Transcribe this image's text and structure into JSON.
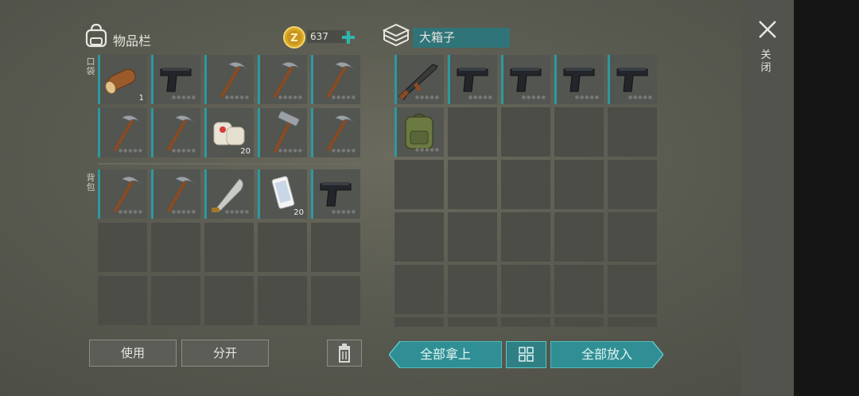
{
  "inventory": {
    "title": "物品栏",
    "coins": "637",
    "coin_symbol": "Z",
    "pocket_label": "口袋",
    "backpack_label": "背包",
    "pocket_items": [
      {
        "name": "wood-log",
        "count": "1"
      },
      {
        "name": "pistol"
      },
      {
        "name": "pickaxe"
      },
      {
        "name": "pickaxe"
      },
      {
        "name": "pickaxe"
      },
      {
        "name": "pickaxe"
      },
      {
        "name": "pickaxe"
      },
      {
        "name": "bandage",
        "count": "20"
      },
      {
        "name": "hammer"
      },
      {
        "name": "pickaxe"
      }
    ],
    "backpack_items": [
      {
        "name": "pickaxe"
      },
      {
        "name": "pickaxe"
      },
      {
        "name": "machete"
      },
      {
        "name": "smartphone",
        "count": "20"
      },
      {
        "name": "pistol"
      }
    ]
  },
  "chest": {
    "title": "大箱子",
    "items": [
      {
        "name": "rifle"
      },
      {
        "name": "pistol"
      },
      {
        "name": "pistol"
      },
      {
        "name": "pistol"
      },
      {
        "name": "pistol"
      },
      {
        "name": "backpack"
      }
    ]
  },
  "buttons": {
    "use": "使用",
    "split": "分开",
    "take_all": "全部拿上",
    "put_all": "全部放入"
  },
  "close_label": "关闭",
  "colors": {
    "accent": "#2a9aa0",
    "slot": "#4c4d47",
    "button_teal": "#2f8f94"
  }
}
